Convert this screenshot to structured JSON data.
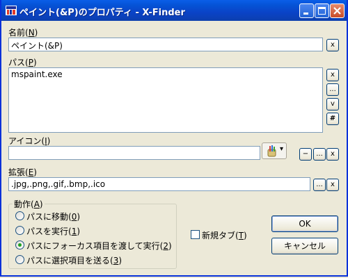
{
  "window": {
    "title": "ペイント(&P)のプロパティ - X-Finder"
  },
  "name_section": {
    "label_text": "名前(",
    "label_key": "N",
    "label_close": ")",
    "value": "ペイント(&P)",
    "clear_button": "x"
  },
  "path_section": {
    "label_text": "パス(",
    "label_key": "P",
    "label_close": ")",
    "value": "mspaint.exe",
    "buttons": {
      "clear": "x",
      "browse": "...",
      "down": "v",
      "hash": "#"
    }
  },
  "icon_section": {
    "label_text": "アイコン(",
    "label_key": "I",
    "label_close": ")",
    "value": "",
    "combo_arrow": "▾",
    "buttons": {
      "minus": "−",
      "browse": "...",
      "clear": "x"
    }
  },
  "ext_section": {
    "label_text": "拡張(",
    "label_key": "E",
    "label_close": ")",
    "value": ".jpg,.png,.gif,.bmp,.ico",
    "buttons": {
      "browse": "...",
      "clear": "x"
    }
  },
  "action_group": {
    "title_text": "動作(",
    "title_key": "A",
    "title_close": ")",
    "options": [
      {
        "text": "パスに移動(",
        "key": "0",
        "close": ")",
        "selected": false
      },
      {
        "text": "パスを実行(",
        "key": "1",
        "close": ")",
        "selected": false
      },
      {
        "text": "パスにフォーカス項目を渡して実行(",
        "key": "2",
        "close": ")",
        "selected": true
      },
      {
        "text": "パスに選択項目を送る(",
        "key": "3",
        "close": ")",
        "selected": false
      }
    ]
  },
  "new_tab": {
    "text": "新規タブ(",
    "key": "T",
    "close": ")",
    "checked": false
  },
  "buttons": {
    "ok": "OK",
    "cancel": "キャンセル"
  },
  "colors": {
    "title_bar": "#0a43c7",
    "window_bg": "#ece9d8",
    "selected_radio": "#21a121"
  }
}
